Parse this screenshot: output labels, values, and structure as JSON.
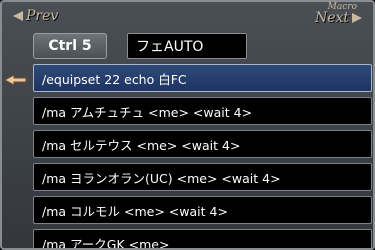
{
  "window": {
    "prev_label": "Prev",
    "next_label": "Next",
    "macro_label": "Macro"
  },
  "macro": {
    "key_label": "Ctrl 5",
    "name": "フェAUTO",
    "selected_index": 0,
    "lines": [
      "/equipset 22 echo 白FC",
      "/ma アムチュチュ <me> <wait 4>",
      "/ma セルテウス <me> <wait 4>",
      "/ma ヨランオラン(UC) <me> <wait 4>",
      "/ma コルモル <me> <wait 4>",
      "/ma アークGK <me>"
    ]
  },
  "colors": {
    "selected_line": "#26407a",
    "nav_text": "#c9b8a0"
  }
}
